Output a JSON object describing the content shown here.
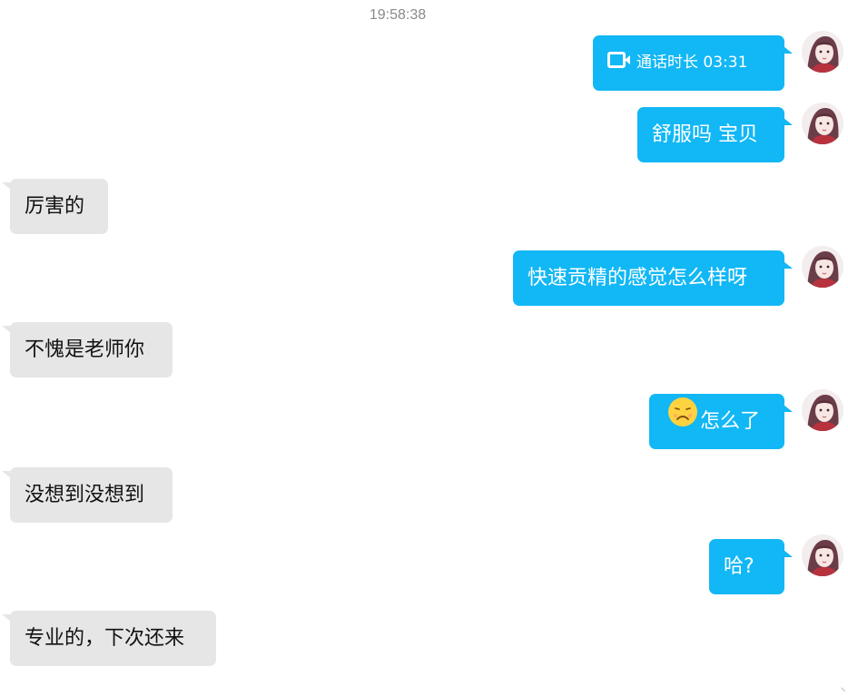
{
  "chat": {
    "timestamp": "19:58:38",
    "messages": [
      {
        "side": "out",
        "type": "video-call",
        "text": "通话时长 03:31",
        "icon": "video-camera-icon"
      },
      {
        "side": "out",
        "type": "text",
        "text": "舒服吗 宝贝"
      },
      {
        "side": "in",
        "type": "text",
        "text": "厉害的"
      },
      {
        "side": "out",
        "type": "text",
        "text": "快速贡精的感觉怎么样呀"
      },
      {
        "side": "in",
        "type": "text",
        "text": "不愧是老师你"
      },
      {
        "side": "out",
        "type": "emoji-text",
        "emoji": "frowning-face-emoji-icon",
        "text": "怎么了"
      },
      {
        "side": "in",
        "type": "text",
        "text": "没想到没想到"
      },
      {
        "side": "out",
        "type": "text",
        "text": "哈?"
      },
      {
        "side": "in",
        "type": "text",
        "text": "专业的，下次还来"
      }
    ]
  },
  "colors": {
    "outgoing_bubble": "#12b7f5",
    "incoming_bubble": "#e6e6e6",
    "timestamp_text": "#8a8a8a"
  }
}
